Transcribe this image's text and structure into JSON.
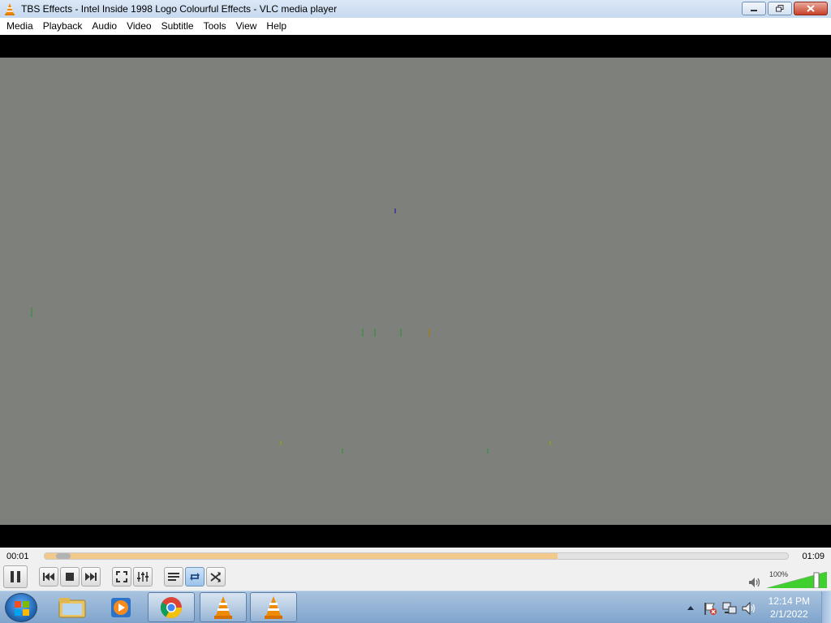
{
  "window": {
    "title": "TBS Effects - Intel Inside 1998 Logo Colourful Effects - VLC media player"
  },
  "menu": [
    "Media",
    "Playback",
    "Audio",
    "Video",
    "Subtitle",
    "Tools",
    "View",
    "Help"
  ],
  "player": {
    "elapsed": "00:01",
    "total": "01:09",
    "progress_fraction": 0.015,
    "buffered_fraction": 0.69,
    "volume_label": "100%",
    "volume_fraction": 1.0
  },
  "taskbar": {
    "clock_time": "12:14 PM",
    "clock_date": "2/1/2022"
  },
  "colors": {
    "vlc_orange": "#f08a00",
    "seek_buffer": "#f2c98b",
    "volume_green": "#3fcf2f",
    "video_bg": "#7e807c"
  }
}
